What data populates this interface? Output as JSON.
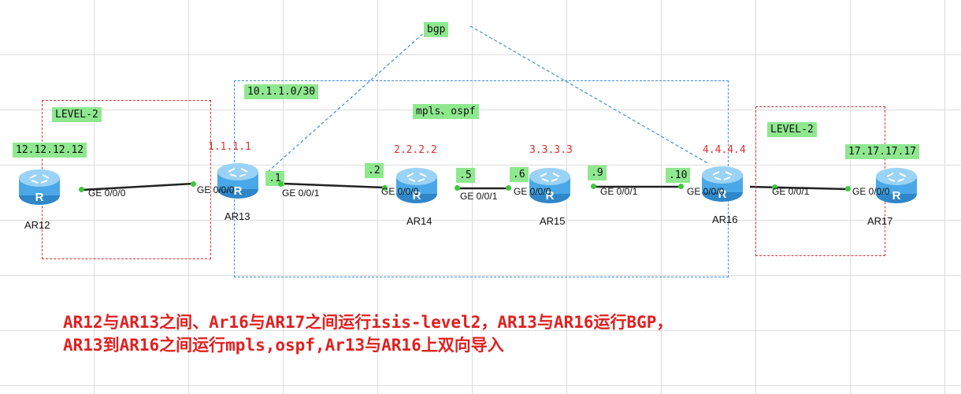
{
  "areas": {
    "left_label": "LEVEL-2",
    "right_label": "LEVEL-2",
    "core_label": "mpls、ospf",
    "subnet_label": "10.1.1.0/30",
    "bgp_label": "bgp"
  },
  "routers": [
    {
      "name": "AR12",
      "loopback": "12.12.12.12"
    },
    {
      "name": "AR13",
      "loopback": "1.1.1.1"
    },
    {
      "name": "AR14",
      "loopback": "2.2.2.2"
    },
    {
      "name": "AR15",
      "loopback": "3.3.3.3"
    },
    {
      "name": "AR16",
      "loopback": "4.4.4.4"
    },
    {
      "name": "AR17",
      "loopback": "17.17.17.17"
    }
  ],
  "interfaces": {
    "ar12_g000": "GE 0/0/0",
    "ar13_g000": "GE 0/0/0",
    "ar13_g001": "GE 0/0/1",
    "ar14_g000": "GE 0/0/0",
    "ar14_g001": "GE 0/0/1",
    "ar15_g000": "GE 0/0/0",
    "ar15_g001": "GE 0/0/1",
    "ar16_g000": "GE 0/0/0",
    "ar16_g001": "GE 0/0/1",
    "ar17_g000": "GE 0/0/0"
  },
  "host_ids": {
    "ar13": ".1",
    "ar14": ".2",
    "ar14_b": ".5",
    "ar15": ".6",
    "ar15_b": ".9",
    "ar16": ".10"
  },
  "note": {
    "line1": "AR12与AR13之间、Ar16与AR17之间运行isis-level2，AR13与AR16运行BGP，",
    "line2": "AR13到AR16之间运行mpls,ospf,Ar13与AR16上双向导入"
  },
  "colors": {
    "link": "#222222",
    "bgp_link": "#3a8de0",
    "label_bg": "#8fe88f",
    "loopback_text": "#e03030",
    "note_text": "#e02020",
    "router_body": "#4aa8e8"
  }
}
